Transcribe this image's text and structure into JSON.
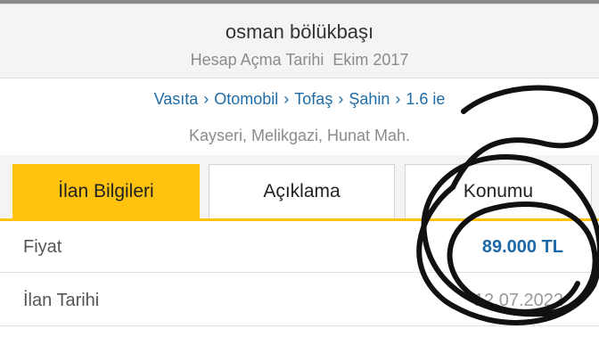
{
  "seller": {
    "name": "osman bölükbaşı",
    "since": "Hesap Açma Tarihi  Ekim 2017"
  },
  "breadcrumb": [
    "Vasıta",
    "Otomobil",
    "Tofaş",
    "Şahin",
    "1.6 ie"
  ],
  "location": "Kayseri, Melikgazi, Hunat Mah.",
  "tabs": [
    {
      "label": "İlan Bilgileri",
      "active": true
    },
    {
      "label": "Açıklama",
      "active": false
    },
    {
      "label": "Konumu",
      "active": false
    }
  ],
  "details": [
    {
      "label": "Fiyat",
      "value": "89.000 TL"
    },
    {
      "label": "İlan Tarihi",
      "value": "12.07.2022"
    }
  ],
  "colors": {
    "accent": "#ffc20e",
    "link": "#1f6ba5",
    "price": "#1d68a8"
  }
}
